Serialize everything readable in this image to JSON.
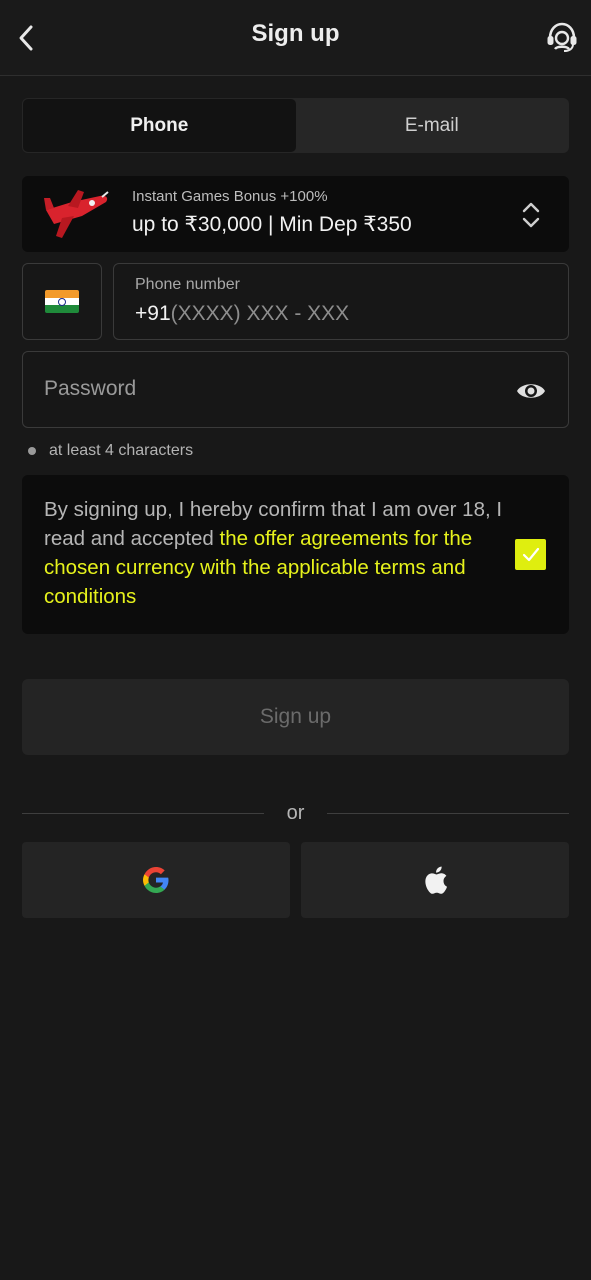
{
  "header": {
    "title": "Sign up",
    "back_icon": "chevron-left-icon",
    "support_icon": "headset-support-icon"
  },
  "tabs": [
    {
      "label": "Phone",
      "active": true
    },
    {
      "label": "E-mail",
      "active": false
    }
  ],
  "bonus": {
    "icon": "airplane-icon",
    "line1": "Instant Games Bonus +100%",
    "line2": "up to ₹30,000 | Min Dep ₹350"
  },
  "phone": {
    "country_flag": "india-flag-icon",
    "label": "Phone number",
    "prefix": "+91",
    "mask": "(XXXX) XXX - XXX"
  },
  "password": {
    "placeholder": "Password",
    "toggle_icon": "eye-icon"
  },
  "hint": "at least 4 characters",
  "terms": {
    "text_before": "By signing up, I hereby confirm that I am over 18, I read and accepted ",
    "link_text": "the offer agreements for the chosen currency with the applicable terms and conditions",
    "checked": true
  },
  "signup_button": "Sign up",
  "divider_text": "or",
  "social": [
    {
      "icon": "google-icon"
    },
    {
      "icon": "apple-icon"
    }
  ],
  "colors": {
    "background": "#181818",
    "accent": "#dfee0f",
    "link": "#e6f21c"
  }
}
